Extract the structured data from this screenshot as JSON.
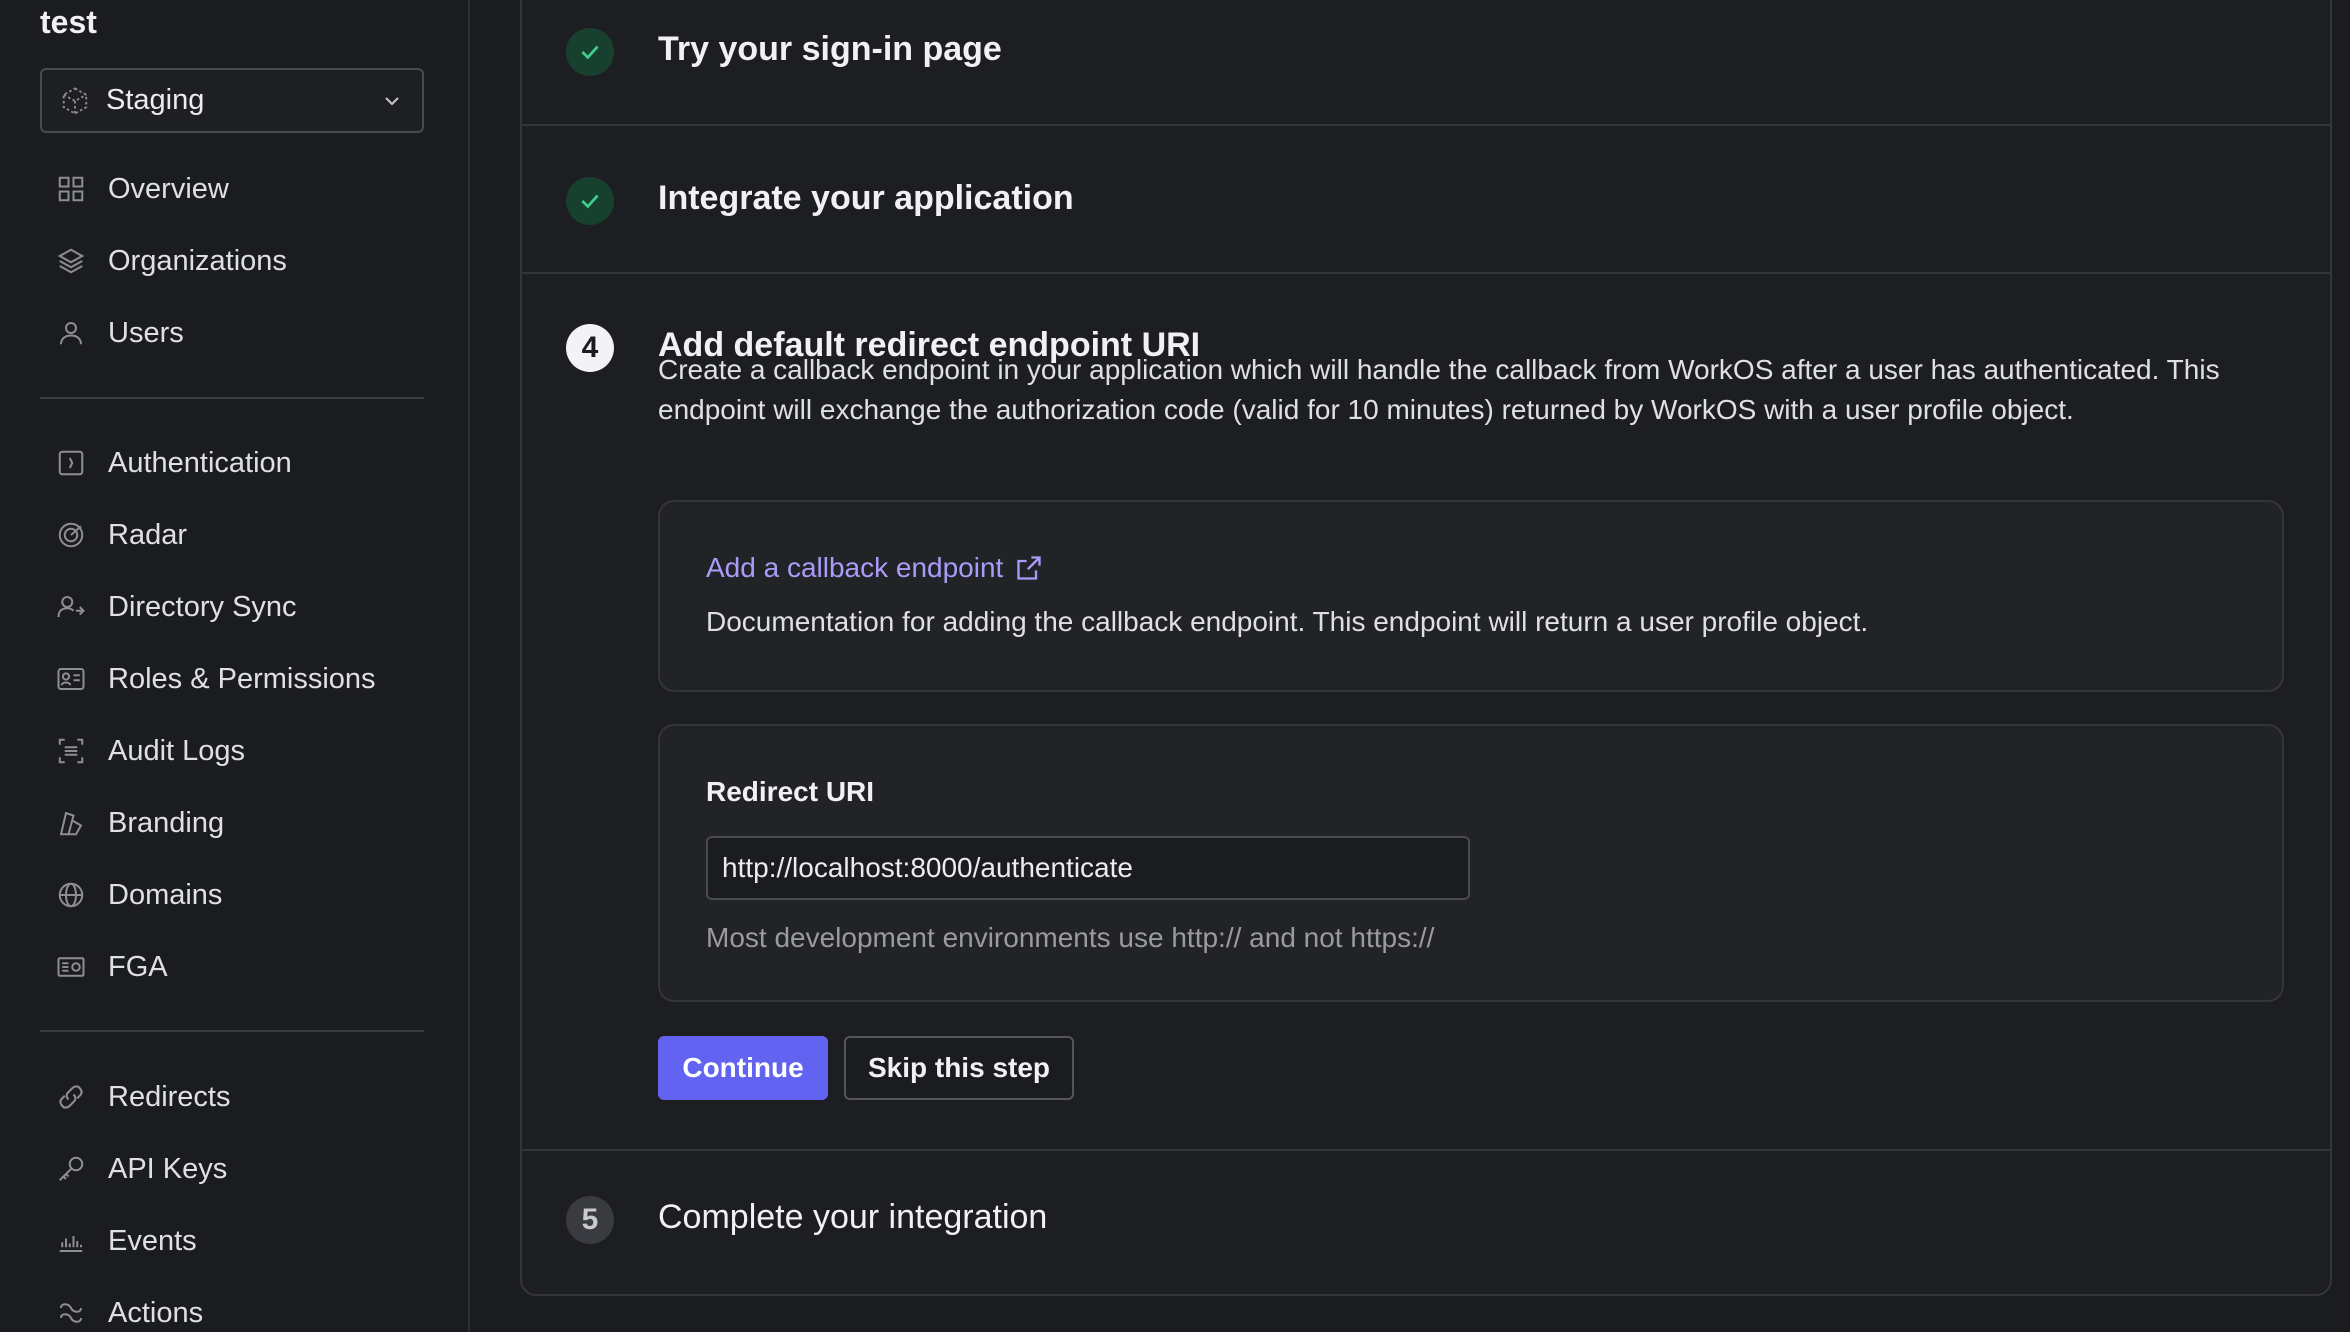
{
  "sidebar": {
    "org_name": "test",
    "environment": {
      "selected": "Staging",
      "icon": "cube-icon"
    },
    "nav_group_1": [
      {
        "label": "Overview",
        "icon": "grid-icon"
      },
      {
        "label": "Organizations",
        "icon": "layers-icon"
      },
      {
        "label": "Users",
        "icon": "user-icon"
      }
    ],
    "nav_group_2": [
      {
        "label": "Authentication",
        "icon": "auth-icon"
      },
      {
        "label": "Radar",
        "icon": "radar-icon"
      },
      {
        "label": "Directory Sync",
        "icon": "directory-sync-icon"
      },
      {
        "label": "Roles & Permissions",
        "icon": "roles-icon"
      },
      {
        "label": "Audit Logs",
        "icon": "audit-logs-icon"
      },
      {
        "label": "Branding",
        "icon": "branding-icon"
      },
      {
        "label": "Domains",
        "icon": "globe-icon"
      },
      {
        "label": "FGA",
        "icon": "fga-icon"
      }
    ],
    "nav_group_3": [
      {
        "label": "Redirects",
        "icon": "link-icon"
      },
      {
        "label": "API Keys",
        "icon": "key-icon"
      },
      {
        "label": "Events",
        "icon": "events-icon"
      },
      {
        "label": "Actions",
        "icon": "actions-icon"
      }
    ]
  },
  "steps": {
    "step_2": {
      "title": "Try your sign-in page",
      "status": "done"
    },
    "step_3": {
      "title": "Integrate your application",
      "status": "done"
    },
    "step_4": {
      "number": "4",
      "title": "Add default redirect endpoint URI",
      "description": "Create a callback endpoint in your application which will handle the callback from WorkOS after a user has authenticated. This endpoint will exchange the authorization code (valid for 10 minutes) returned by WorkOS with a user profile object.",
      "doc_link": "Add a callback endpoint",
      "doc_text": "Documentation for adding the callback endpoint. This endpoint will return a user profile object.",
      "uri_label": "Redirect URI",
      "uri_value": "http://localhost:8000/authenticate",
      "uri_hint": "Most development environments use http:// and not https://",
      "continue_label": "Continue",
      "skip_label": "Skip this step"
    },
    "step_5": {
      "number": "5",
      "title": "Complete your integration",
      "status": "pending"
    }
  },
  "colors": {
    "accent": "#6363f1",
    "link": "#a99cf8",
    "success": "#3ecf8e",
    "background": "#1b1c1f"
  }
}
